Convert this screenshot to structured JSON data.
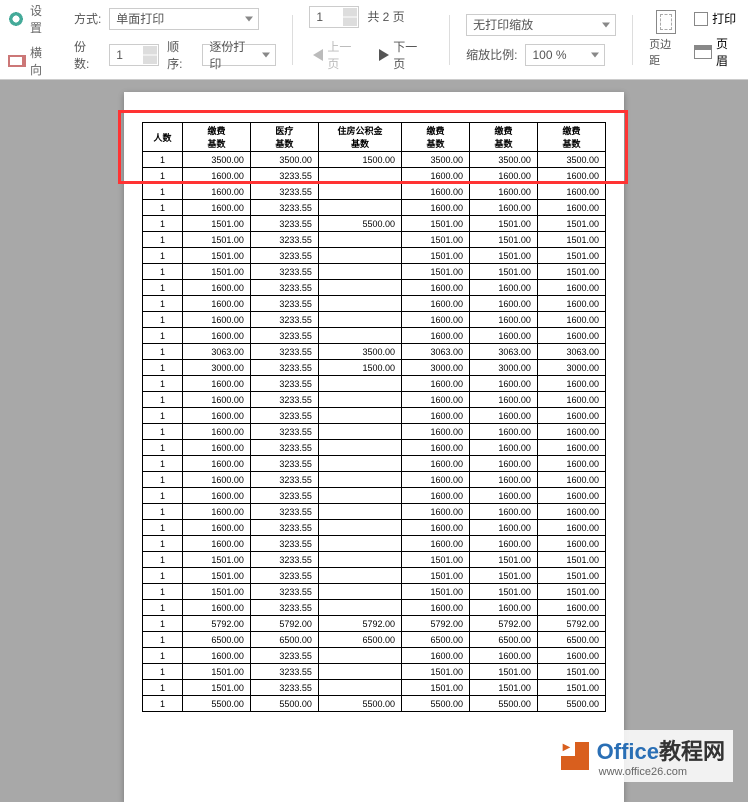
{
  "toolbar": {
    "settings": "设置",
    "landscape": "横向",
    "mode_label": "方式:",
    "mode_value": "单面打印",
    "copies_label": "份数:",
    "copies_value": "1",
    "order_label": "顺序:",
    "order_value": "逐份打印",
    "page_current": "1",
    "page_total_label": "共 2 页",
    "prev": "上一页",
    "next": "下一页",
    "scale_mode": "无打印缩放",
    "scale_label": "缩放比例:",
    "scale_value": "100 %",
    "margins": "页边距",
    "print_checkbox": "打印",
    "header_footer": "页眉"
  },
  "table": {
    "headers": [
      "人数",
      "缴费\n基数",
      "医疗\n基数",
      "住房公积金\n基数",
      "缴费\n基数",
      "缴费\n基数",
      "缴费\n基数"
    ],
    "rows": [
      [
        "1",
        "3500.00",
        "3500.00",
        "1500.00",
        "3500.00",
        "3500.00",
        "3500.00"
      ],
      [
        "1",
        "1600.00",
        "3233.55",
        "",
        "1600.00",
        "1600.00",
        "1600.00"
      ],
      [
        "1",
        "1600.00",
        "3233.55",
        "",
        "1600.00",
        "1600.00",
        "1600.00"
      ],
      [
        "1",
        "1600.00",
        "3233.55",
        "",
        "1600.00",
        "1600.00",
        "1600.00"
      ],
      [
        "1",
        "1501.00",
        "3233.55",
        "5500.00",
        "1501.00",
        "1501.00",
        "1501.00"
      ],
      [
        "1",
        "1501.00",
        "3233.55",
        "",
        "1501.00",
        "1501.00",
        "1501.00"
      ],
      [
        "1",
        "1501.00",
        "3233.55",
        "",
        "1501.00",
        "1501.00",
        "1501.00"
      ],
      [
        "1",
        "1501.00",
        "3233.55",
        "",
        "1501.00",
        "1501.00",
        "1501.00"
      ],
      [
        "1",
        "1600.00",
        "3233.55",
        "",
        "1600.00",
        "1600.00",
        "1600.00"
      ],
      [
        "1",
        "1600.00",
        "3233.55",
        "",
        "1600.00",
        "1600.00",
        "1600.00"
      ],
      [
        "1",
        "1600.00",
        "3233.55",
        "",
        "1600.00",
        "1600.00",
        "1600.00"
      ],
      [
        "1",
        "1600.00",
        "3233.55",
        "",
        "1600.00",
        "1600.00",
        "1600.00"
      ],
      [
        "1",
        "3063.00",
        "3233.55",
        "3500.00",
        "3063.00",
        "3063.00",
        "3063.00"
      ],
      [
        "1",
        "3000.00",
        "3233.55",
        "1500.00",
        "3000.00",
        "3000.00",
        "3000.00"
      ],
      [
        "1",
        "1600.00",
        "3233.55",
        "",
        "1600.00",
        "1600.00",
        "1600.00"
      ],
      [
        "1",
        "1600.00",
        "3233.55",
        "",
        "1600.00",
        "1600.00",
        "1600.00"
      ],
      [
        "1",
        "1600.00",
        "3233.55",
        "",
        "1600.00",
        "1600.00",
        "1600.00"
      ],
      [
        "1",
        "1600.00",
        "3233.55",
        "",
        "1600.00",
        "1600.00",
        "1600.00"
      ],
      [
        "1",
        "1600.00",
        "3233.55",
        "",
        "1600.00",
        "1600.00",
        "1600.00"
      ],
      [
        "1",
        "1600.00",
        "3233.55",
        "",
        "1600.00",
        "1600.00",
        "1600.00"
      ],
      [
        "1",
        "1600.00",
        "3233.55",
        "",
        "1600.00",
        "1600.00",
        "1600.00"
      ],
      [
        "1",
        "1600.00",
        "3233.55",
        "",
        "1600.00",
        "1600.00",
        "1600.00"
      ],
      [
        "1",
        "1600.00",
        "3233.55",
        "",
        "1600.00",
        "1600.00",
        "1600.00"
      ],
      [
        "1",
        "1600.00",
        "3233.55",
        "",
        "1600.00",
        "1600.00",
        "1600.00"
      ],
      [
        "1",
        "1600.00",
        "3233.55",
        "",
        "1600.00",
        "1600.00",
        "1600.00"
      ],
      [
        "1",
        "1501.00",
        "3233.55",
        "",
        "1501.00",
        "1501.00",
        "1501.00"
      ],
      [
        "1",
        "1501.00",
        "3233.55",
        "",
        "1501.00",
        "1501.00",
        "1501.00"
      ],
      [
        "1",
        "1501.00",
        "3233.55",
        "",
        "1501.00",
        "1501.00",
        "1501.00"
      ],
      [
        "1",
        "1600.00",
        "3233.55",
        "",
        "1600.00",
        "1600.00",
        "1600.00"
      ],
      [
        "1",
        "5792.00",
        "5792.00",
        "5792.00",
        "5792.00",
        "5792.00",
        "5792.00"
      ],
      [
        "1",
        "6500.00",
        "6500.00",
        "6500.00",
        "6500.00",
        "6500.00",
        "6500.00"
      ],
      [
        "1",
        "1600.00",
        "3233.55",
        "",
        "1600.00",
        "1600.00",
        "1600.00"
      ],
      [
        "1",
        "1501.00",
        "3233.55",
        "",
        "1501.00",
        "1501.00",
        "1501.00"
      ],
      [
        "1",
        "1501.00",
        "3233.55",
        "",
        "1501.00",
        "1501.00",
        "1501.00"
      ],
      [
        "1",
        "5500.00",
        "5500.00",
        "5500.00",
        "5500.00",
        "5500.00",
        "5500.00"
      ]
    ]
  },
  "watermark": {
    "brand1": "Office",
    "brand2": "教程网",
    "url": "www.office26.com"
  }
}
